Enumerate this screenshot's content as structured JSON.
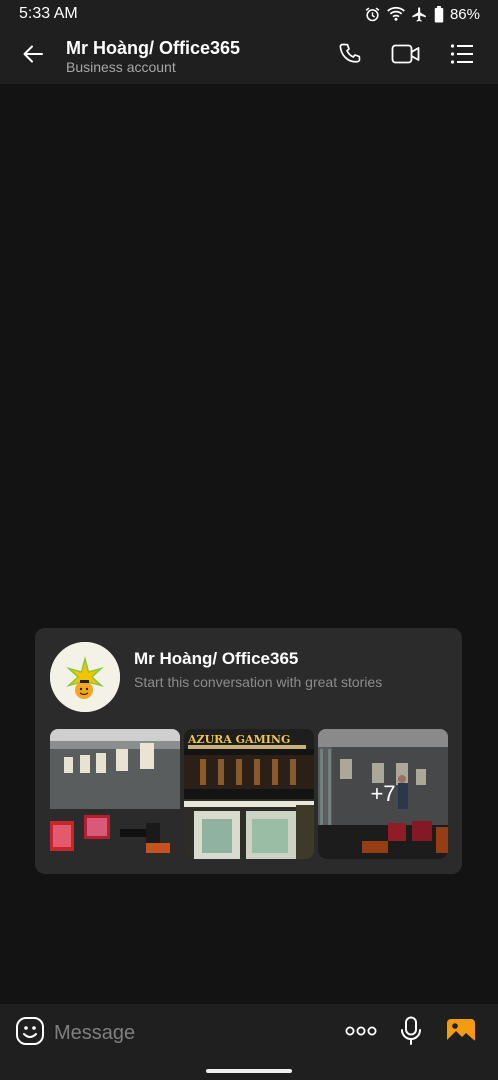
{
  "status": {
    "time": "5:33 AM",
    "battery": "86%",
    "icons": [
      "alarm-icon",
      "wifi-icon",
      "airplane-icon",
      "battery-icon"
    ]
  },
  "header": {
    "title": "Mr Hoàng/ Office365",
    "subtitle": "Business account",
    "icons": [
      "back-arrow-icon",
      "phone-icon",
      "video-camera-icon",
      "list-menu-icon"
    ]
  },
  "card": {
    "name": "Mr Hoàng/ Office365",
    "subtitle": "Start this conversation with great stories",
    "photos": [
      {
        "label": "",
        "icon": "gaming-room-photo"
      },
      {
        "label": "",
        "icon": "storefront-photo"
      },
      {
        "label": "+7",
        "icon": "gaming-room-photo"
      }
    ]
  },
  "composer": {
    "placeholder": "Message",
    "icons": [
      "sticker-icon",
      "more-dots-icon",
      "microphone-icon",
      "image-icon"
    ]
  },
  "colors": {
    "background": "#131313",
    "bar": "#1f1f1f",
    "card": "#2b2b2b",
    "accent_orange": "#f39c12"
  }
}
